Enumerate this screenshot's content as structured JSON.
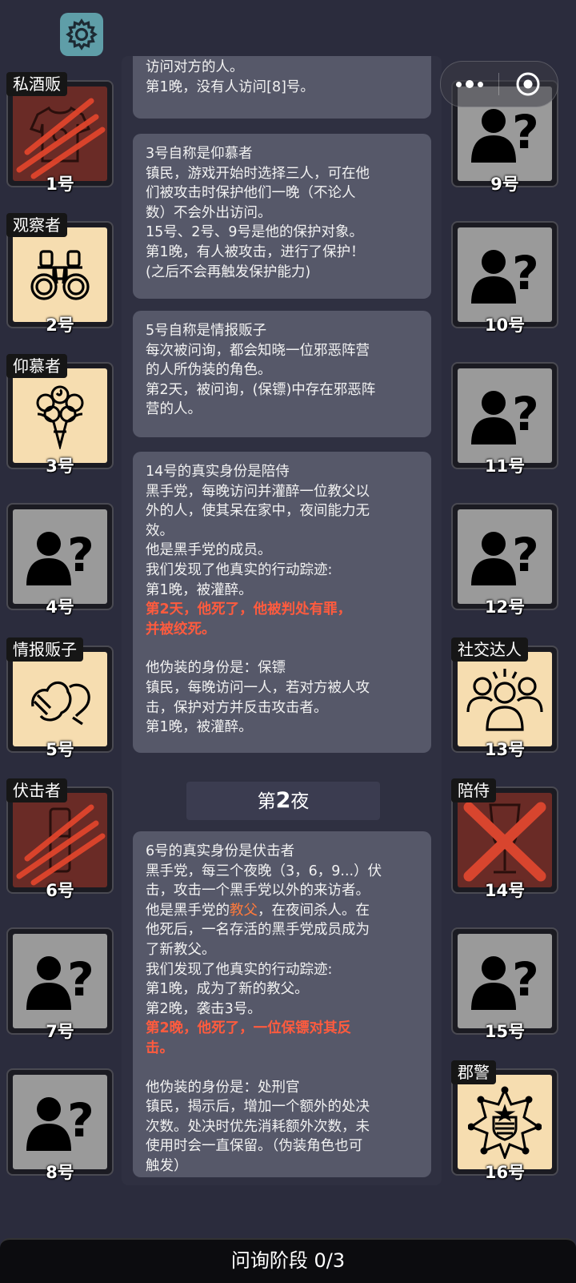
{
  "players": [
    {
      "num": "1号",
      "tag": "私酒贩",
      "state": "dead",
      "icon": "shirt-icon"
    },
    {
      "num": "2号",
      "tag": "观察者",
      "state": "role",
      "icon": "binoculars-icon"
    },
    {
      "num": "3号",
      "tag": "仰慕者",
      "state": "role",
      "icon": "bouquet-icon"
    },
    {
      "num": "4号",
      "tag": "",
      "state": "unknown",
      "icon": "unknown-person-icon"
    },
    {
      "num": "5号",
      "tag": "情报贩子",
      "state": "role",
      "icon": "whisper-icon"
    },
    {
      "num": "6号",
      "tag": "伏击者",
      "state": "dead",
      "icon": "knife-icon"
    },
    {
      "num": "7号",
      "tag": "",
      "state": "unknown",
      "icon": "unknown-person-icon"
    },
    {
      "num": "8号",
      "tag": "",
      "state": "unknown",
      "icon": "unknown-person-icon"
    },
    {
      "num": "9号",
      "tag": "",
      "state": "unknown",
      "icon": "unknown-person-icon"
    },
    {
      "num": "10号",
      "tag": "",
      "state": "unknown",
      "icon": "unknown-person-icon"
    },
    {
      "num": "11号",
      "tag": "",
      "state": "unknown",
      "icon": "unknown-person-icon"
    },
    {
      "num": "12号",
      "tag": "",
      "state": "unknown",
      "icon": "unknown-person-icon"
    },
    {
      "num": "13号",
      "tag": "社交达人",
      "state": "role",
      "icon": "crowd-icon"
    },
    {
      "num": "14号",
      "tag": "陪侍",
      "state": "dead",
      "icon": "wine-glass-icon"
    },
    {
      "num": "15号",
      "tag": "",
      "state": "unknown",
      "icon": "unknown-person-icon"
    },
    {
      "num": "16号",
      "tag": "郡警",
      "state": "role",
      "icon": "sheriff-badge-icon"
    }
  ],
  "cards": [
    {
      "lines": [
        "访问对方的人。",
        "第1晚，没有人访问[8]号。"
      ]
    },
    {
      "lines": [
        "3号自称是仰慕者",
        "镇民，游戏开始时选择三人，可在他",
        "们被攻击时保护他们一晚（不论人",
        "数）不会外出访问。",
        "15号、2号、9号是他的保护对象。",
        "第1晚，有人被攻击，进行了保护！",
        "(之后不会再触发保护能力)"
      ]
    },
    {
      "lines": [
        "5号自称是情报贩子",
        "每次被问询，都会知晓一位邪恶阵营",
        "的人所伪装的角色。",
        "第2天，被问询，(保镖)中存在邪恶阵",
        "营的人。"
      ]
    },
    {
      "lines": [
        "14号的真实身份是陪侍",
        "黑手党，每晚访问并灌醉一位教父以",
        "外的人，使其呆在家中，夜间能力无",
        "效。",
        "他是黑手党的成员。",
        "我们发现了他真实的行动踪迹:",
        "第1晚，被灌醉。"
      ],
      "red": [
        "第2天，他死了，他被判处有罪，",
        "并被绞死。"
      ],
      "after": [
        "他伪装的身份是：保镖",
        "镇民，每晚访问一人，若对方被人攻",
        "击，保护对方并反击攻击者。",
        "第1晚，被灌醉。"
      ]
    },
    {
      "lines": [
        "6号的真实身份是伏击者",
        "黑手党，每三个夜晚（3，6，9...）伏",
        "击，攻击一个黑手党以外的来访者。"
      ],
      "mixed": {
        "pre": "他是黑手党的",
        "hl": "教父",
        "post": "，在夜间杀人。在"
      },
      "lines2": [
        "他死后，一名存活的黑手党成员成为",
        "了新教父。",
        "我们发现了他真实的行动踪迹:",
        "第1晚，成为了新的教父。",
        "第2晚，袭击3号。"
      ],
      "red": [
        "第2晚，他死了，一位保镖对其反",
        "击。"
      ],
      "after": [
        "他伪装的身份是：处刑官",
        "镇民，揭示后，增加一个额外的处决",
        "次数。处决时优先消耗额外次数，未",
        "使用时会一直保留。（伪装角色也可",
        "触发）"
      ]
    }
  ],
  "phase": {
    "prefix": "第",
    "num": "2",
    "suffix": "夜"
  },
  "status_bar": "问询阶段 0/3",
  "colors": {
    "background": "#2b2c3d",
    "card": "#565869",
    "dead_tile": "#6a2b26",
    "role_tile": "#f6ddb0",
    "unknown_tile": "#9a9a9a",
    "highlight": "#ff5b3e",
    "gear": "#5f9ea8"
  }
}
